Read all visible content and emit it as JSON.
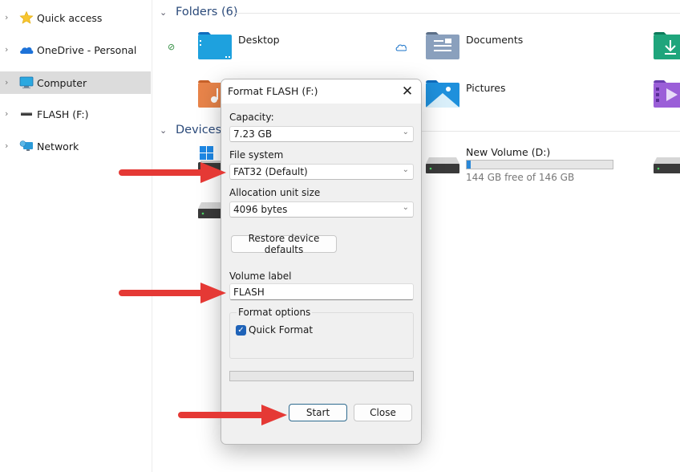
{
  "sidebar": {
    "items": [
      {
        "label": "Quick access",
        "icon": "star-icon",
        "selected": false
      },
      {
        "label": "OneDrive - Personal",
        "icon": "cloud-icon",
        "selected": false
      },
      {
        "label": "Computer",
        "icon": "monitor-icon",
        "selected": true
      },
      {
        "label": "FLASH (F:)",
        "icon": "usb-drive-icon",
        "selected": false
      },
      {
        "label": "Network",
        "icon": "network-icon",
        "selected": false
      }
    ]
  },
  "main": {
    "folders_header": "Folders (6)",
    "devices_header": "Devices a",
    "folders": [
      {
        "label": "Desktop",
        "status": "synced"
      },
      {
        "label": "Documents",
        "status": "cloud"
      },
      {
        "label": "Downloads",
        "status": ""
      },
      {
        "label": "Music",
        "status": ""
      },
      {
        "label": "Pictures",
        "status": ""
      },
      {
        "label": "Videos",
        "status": ""
      }
    ],
    "drives": [
      {
        "label": "New Volume (D:)",
        "free_text": "144 GB free of 146 GB",
        "used_fraction": 0.014
      }
    ]
  },
  "dialog": {
    "title": "Format FLASH (F:)",
    "close_glyph": "✕",
    "capacity_label": "Capacity:",
    "capacity_value": "7.23 GB",
    "filesystem_label": "File system",
    "filesystem_value": "FAT32 (Default)",
    "allocation_label": "Allocation unit size",
    "allocation_value": "4096 bytes",
    "restore_button": "Restore device defaults",
    "volume_label_label": "Volume label",
    "volume_label_value": "FLASH",
    "format_options_label": "Format options",
    "quick_format_label": "Quick Format",
    "quick_format_checked": true,
    "progress": 0,
    "start_button": "Start",
    "close_button": "Close"
  },
  "colors": {
    "accent": "#1f63b8",
    "arrow": "#e53935",
    "selected_bg": "#dcdcdc"
  }
}
